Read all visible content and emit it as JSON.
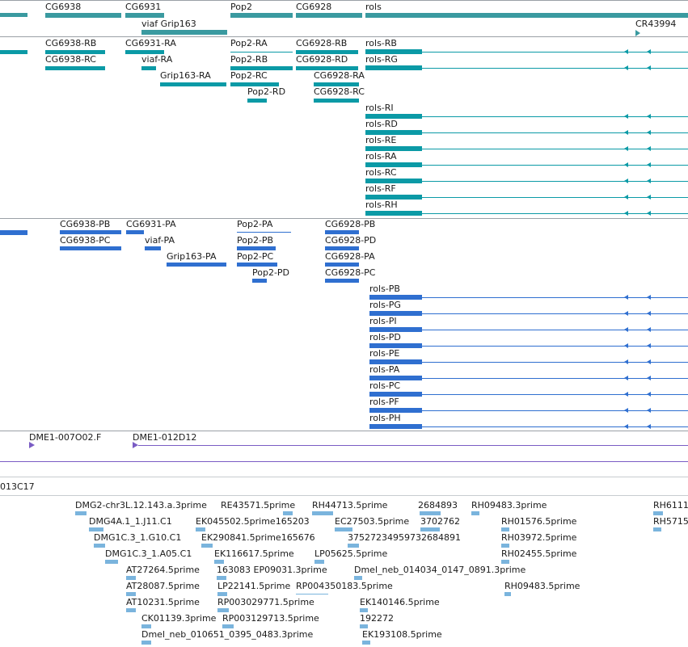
{
  "colors": {
    "gene": "#3a9aa0",
    "transcript": "#0b9aa6",
    "protein": "#2f6fd0",
    "cdna": "#7a5cc4",
    "est": "#7ab4dd",
    "divider": "#9aa0a6"
  },
  "genes": [
    {
      "label": "CG6938"
    },
    {
      "label": "CG6931"
    },
    {
      "label": "Pop2"
    },
    {
      "label": "CG6928"
    },
    {
      "label": "rols"
    },
    {
      "label": "viaf Grip163"
    },
    {
      "label": "CR43994"
    }
  ],
  "transcripts": [
    {
      "label": "CG6938-RB"
    },
    {
      "label": "CG6931-RA"
    },
    {
      "label": "Pop2-RA"
    },
    {
      "label": "CG6928-RB"
    },
    {
      "label": "rols-RB"
    },
    {
      "label": "CG6938-RC"
    },
    {
      "label": "viaf-RA"
    },
    {
      "label": "Pop2-RB"
    },
    {
      "label": "CG6928-RD"
    },
    {
      "label": "rols-RG"
    },
    {
      "label": "Grip163-RA"
    },
    {
      "label": "Pop2-RC"
    },
    {
      "label": "CG6928-RA"
    },
    {
      "label": "Pop2-RD"
    },
    {
      "label": "CG6928-RC"
    },
    {
      "label": "rols-RI"
    },
    {
      "label": "rols-RD"
    },
    {
      "label": "rols-RE"
    },
    {
      "label": "rols-RA"
    },
    {
      "label": "rols-RC"
    },
    {
      "label": "rols-RF"
    },
    {
      "label": "rols-RH"
    }
  ],
  "proteins": [
    {
      "label": "CG6938-PB"
    },
    {
      "label": "CG6931-PA"
    },
    {
      "label": "Pop2-PA"
    },
    {
      "label": "CG6928-PB"
    },
    {
      "label": "CG6938-PC"
    },
    {
      "label": "viaf-PA"
    },
    {
      "label": "Pop2-PB"
    },
    {
      "label": "CG6928-PD"
    },
    {
      "label": "Grip163-PA"
    },
    {
      "label": "Pop2-PC"
    },
    {
      "label": "CG6928-PA"
    },
    {
      "label": "Pop2-PD"
    },
    {
      "label": "CG6928-PC"
    },
    {
      "label": "rols-PB"
    },
    {
      "label": "rols-PG"
    },
    {
      "label": "rols-PI"
    },
    {
      "label": "rols-PD"
    },
    {
      "label": "rols-PE"
    },
    {
      "label": "rols-PA"
    },
    {
      "label": "rols-PC"
    },
    {
      "label": "rols-PF"
    },
    {
      "label": "rols-PH"
    }
  ],
  "cdna": [
    {
      "label": "DME1-007O02.F"
    },
    {
      "label": "DME1-012D12"
    },
    {
      "label": "013C17"
    }
  ],
  "ests": [
    {
      "label": "DMG2-chr3L.12.143.a.3prime"
    },
    {
      "label": "RE43571.5prime"
    },
    {
      "label": "RH44713.5prime"
    },
    {
      "label": "2684893"
    },
    {
      "label": "RH09483.3prime"
    },
    {
      "label": "RH6111"
    },
    {
      "label": "DMG4A.1_1.J11.C1"
    },
    {
      "label": "EK045502.5prime165203"
    },
    {
      "label": "EC27503.5prime"
    },
    {
      "label": "3702762"
    },
    {
      "label": "RH01576.5prime"
    },
    {
      "label": "RH5715"
    },
    {
      "label": "DMG1C.3_1.G10.C1"
    },
    {
      "label": "EK290841.5prime165676"
    },
    {
      "label": "37527234959732684891"
    },
    {
      "label": "RH03972.5prime"
    },
    {
      "label": "DMG1C.3_1.A05.C1"
    },
    {
      "label": "EK116617.5prime"
    },
    {
      "label": "LP05625.5prime"
    },
    {
      "label": "RH02455.5prime"
    },
    {
      "label": "AT27264.5prime"
    },
    {
      "label": "163083 EP09031.3prime"
    },
    {
      "label": "Dmel_neb_014034_0147_0891.3prime"
    },
    {
      "label": "AT28087.5prime"
    },
    {
      "label": "LP22141.5prime"
    },
    {
      "label": "RP004350183.5prime"
    },
    {
      "label": "RH09483.5prime"
    },
    {
      "label": "AT10231.5prime"
    },
    {
      "label": "RP003029771.5prime"
    },
    {
      "label": "EK140146.5prime"
    },
    {
      "label": "CK01139.3prime"
    },
    {
      "label": "RP003129713.5prime"
    },
    {
      "label": "192272"
    },
    {
      "label": "Dmel_neb_010651_0395_0483.3prime"
    },
    {
      "label": "EK193108.5prime"
    }
  ]
}
